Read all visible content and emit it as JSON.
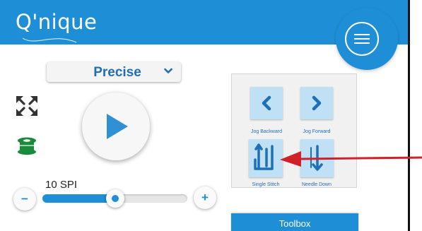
{
  "header": {
    "logo_text": "Q'nique",
    "menu_icon": "hamburger-menu-icon"
  },
  "controls": {
    "mode": {
      "selected": "Precise"
    },
    "expand_icon": "expand-arrows-icon",
    "spool_icon": "thread-spool-icon",
    "play_icon": "play-icon"
  },
  "stitch": {
    "spi_label": "10 SPI",
    "minus_label": "−",
    "plus_label": "+",
    "slider_level_fraction": 0.5
  },
  "jog_panel": {
    "buttons": [
      {
        "label": "Jog Backward",
        "icon": "chevron-left-icon"
      },
      {
        "label": "Jog Forward",
        "icon": "chevron-right-icon"
      },
      {
        "label": "Single Stitch",
        "icon": "single-stitch-icon"
      },
      {
        "label": "Needle Down",
        "icon": "needle-down-icon"
      }
    ]
  },
  "toolbox": {
    "label": "Toolbox"
  },
  "colors": {
    "brand_blue": "#1e8fd6",
    "button_light_blue": "#bfe0f5",
    "spool_green": "#1a8a3c",
    "annotation_red": "#d0202a"
  }
}
